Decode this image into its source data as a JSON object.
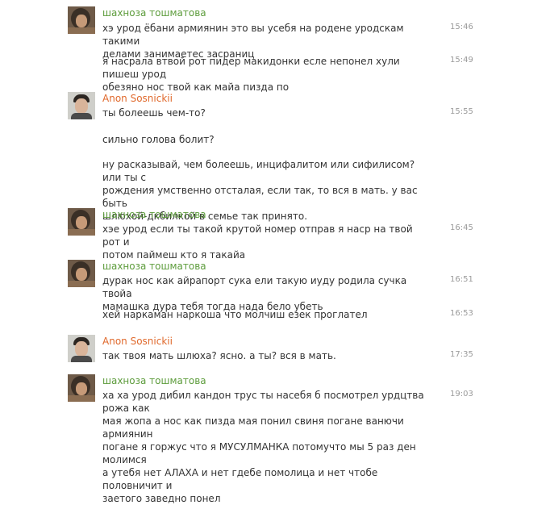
{
  "messages": [
    {
      "author": "шахноза тошматова",
      "author_color": "#5d9c3c",
      "lines": [
        {
          "text": "хэ урод ёбани армиянин это вы усебя на родене уродскам такими\nделами занимаетес засраниц",
          "time": "15:46"
        },
        {
          "text": "я насрала втвой рот пидер макидонки есле непонел хули пишеш урод\nобезяно нос твой как майа пизда по",
          "time": "15:49"
        }
      ]
    },
    {
      "author": "Anon Sosnickii",
      "author_color": "#e0692c",
      "lines": [
        {
          "text": "ты болеешь чем-то?",
          "time": "15:55"
        },
        {
          "text": "сильно голова болит?",
          "time": ""
        },
        {
          "text": "ну расказывай, чем болеешь, инцифалитом или сифилисом? или ты с\nрождения умственно отсталая, если так, то вся в мать. у вас быть\nшлюхой-дкбилкой в семье так принято.",
          "time": ""
        }
      ]
    },
    {
      "author": "шахноза тошматова",
      "author_color": "#5d9c3c",
      "lines": [
        {
          "text": "хэе урод если ты такой крутой номер отправ я наср на твой рот и\nпотом паймеш кто я такайа",
          "time": "16:45"
        }
      ]
    },
    {
      "author": "шахноза тошматова",
      "author_color": "#5d9c3c",
      "lines": [
        {
          "text": "дурак нос как айрапорт сука ели такую иуду родила сучка твойа\nмамашка дура тебя тогда нада бело убеть",
          "time": "16:51"
        },
        {
          "text": "хей наркаман наркоша что молчиш езек проглател",
          "time": "16:53"
        }
      ]
    },
    {
      "author": "Anon Sosnickii",
      "author_color": "#e0692c",
      "lines": [
        {
          "text": "так твоя мать шлюха? ясно. а ты? вся в мать.",
          "time": "17:35"
        }
      ]
    },
    {
      "author": "шахноза тошматова",
      "author_color": "#5d9c3c",
      "lines": [
        {
          "text": "ха ха урод дибил кандон трус ты насебя б посмотрел урдцтва рожа как\nмая жопа а нос как пизда мая понил свиня погане ванючи армиянин\nпогане я горжус что я МУСУЛМАНКА потомучто мы 5 раз ден молимся\nа утебя нет АЛАХА и нет гдебе помолица и нет чтобе половничит и\nзаетого заведно понел",
          "time": "19:03"
        }
      ]
    }
  ]
}
